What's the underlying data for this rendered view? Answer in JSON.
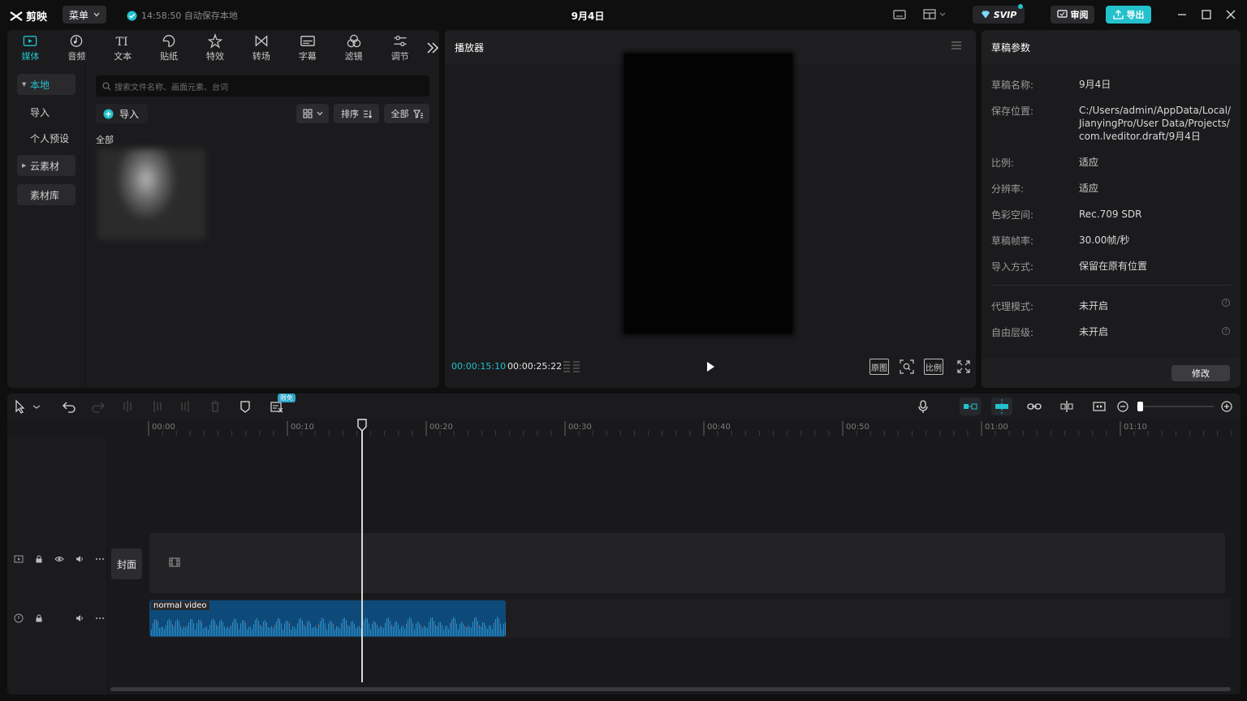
{
  "app": {
    "name": "剪映",
    "menu_label": "菜单",
    "autosave": "14:58:50 自动保存本地",
    "doc_title": "9月4日",
    "svip": "SVIP",
    "review": "审阅",
    "export": "导出"
  },
  "colors": {
    "accent": "#23c1cc",
    "clip": "#0e4a79",
    "waveform": "#2d8fc9"
  },
  "media": {
    "tabs": [
      {
        "label": "媒体",
        "icon": "media-icon"
      },
      {
        "label": "音频",
        "icon": "audio-icon"
      },
      {
        "label": "文本",
        "icon": "text-icon"
      },
      {
        "label": "贴纸",
        "icon": "sticker-icon"
      },
      {
        "label": "特效",
        "icon": "effects-icon"
      },
      {
        "label": "转场",
        "icon": "transition-icon"
      },
      {
        "label": "字幕",
        "icon": "subtitle-icon"
      },
      {
        "label": "滤镜",
        "icon": "filter-icon"
      },
      {
        "label": "调节",
        "icon": "adjust-icon"
      }
    ],
    "sidebar": {
      "local": "本地",
      "import": "导入",
      "preset": "个人预设",
      "cloud": "云素材",
      "library": "素材库"
    },
    "search_placeholder": "搜索文件名称、画面元素、台词",
    "import_label": "导入",
    "sort_label": "排序",
    "filter_label": "全部",
    "section_all": "全部"
  },
  "player": {
    "title": "播放器",
    "current": "00:00:15:10",
    "total": "00:00:25:22",
    "original": "原图",
    "ratio": "比例"
  },
  "draft": {
    "title": "草稿参数",
    "rows": [
      {
        "k": "草稿名称:",
        "v": "9月4日"
      },
      {
        "k": "保存位置:",
        "v": "C:/Users/admin/AppData/Local/JianyingPro/User Data/Projects/com.lveditor.draft/9月4日"
      },
      {
        "k": "比例:",
        "v": "适应"
      },
      {
        "k": "分辨率:",
        "v": "适应"
      },
      {
        "k": "色彩空间:",
        "v": "Rec.709 SDR"
      },
      {
        "k": "草稿帧率:",
        "v": "30.00帧/秒"
      },
      {
        "k": "导入方式:",
        "v": "保留在原有位置"
      },
      {
        "k": "代理模式:",
        "v": "未开启"
      },
      {
        "k": "自由层级:",
        "v": "未开启"
      }
    ],
    "modify": "修改"
  },
  "timeline": {
    "ticks": [
      "00:00",
      "00:10",
      "00:20",
      "00:30",
      "00:40",
      "00:50",
      "01:00",
      "01:10"
    ],
    "free_badge": "限免",
    "cover": "封面",
    "audio_clip": "normal video"
  }
}
